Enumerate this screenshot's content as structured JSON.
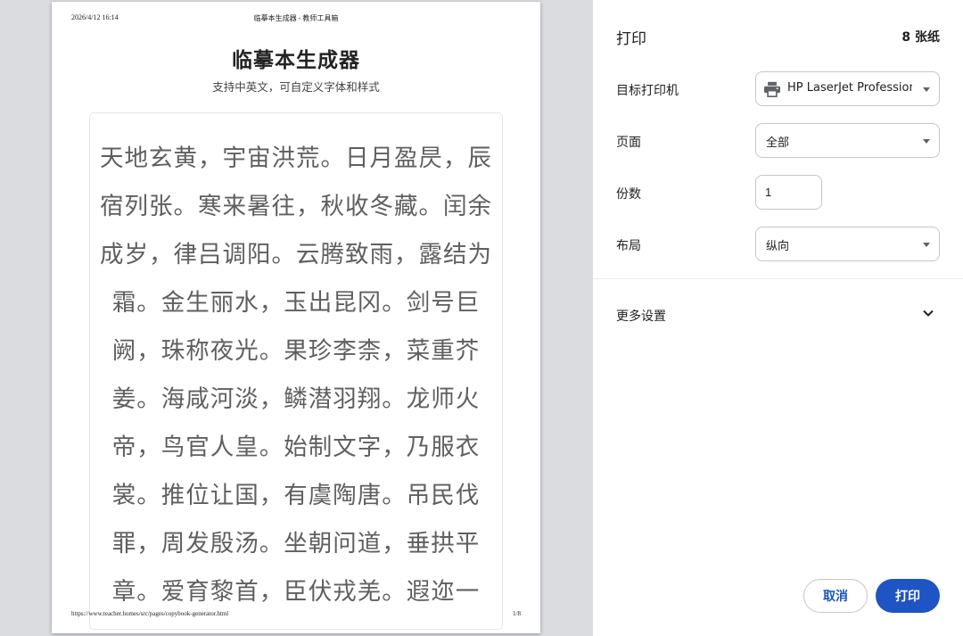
{
  "preview": {
    "header_datetime": "2026/4/12 16:14",
    "header_title": "临摹本生成器 - 教师工具箱",
    "doc_title": "临摹本生成器",
    "doc_subtitle": "支持中英文，可自定义字体和样式",
    "practice_lines": [
      "天地玄黄，宇宙洪荒。日月盈昃，辰",
      "宿列张。寒来暑往，秋收冬藏。闰余",
      "成岁，律吕调阳。云腾致雨，露结为",
      "霜。金生丽水，玉出昆冈。剑号巨",
      "阙，珠称夜光。果珍李柰，菜重芥",
      "姜。海咸河淡，鳞潜羽翔。龙师火",
      "帝，鸟官人皇。始制文字，乃服衣",
      "裳。推位让国，有虞陶唐。吊民伐",
      "罪，周发殷汤。坐朝问道，垂拱平",
      "章。爱育黎首，臣伏戎羌。遐迩一"
    ],
    "footer_url": "https://www.teacher.homes/src/pages/copybook-generator.html",
    "footer_page": "1/8"
  },
  "print_panel": {
    "title": "打印",
    "sheet_count": "8 张纸",
    "destination_label": "目标打印机",
    "destination_value": "HP LaserJet Professional",
    "destination_icon": "printer-icon",
    "pages_label": "页面",
    "pages_value": "全部",
    "copies_label": "份数",
    "copies_value": "1",
    "layout_label": "布局",
    "layout_value": "纵向",
    "more_settings_label": "更多设置",
    "more_settings_icon": "chevron-down-icon",
    "cancel_label": "取消",
    "print_label": "打印"
  },
  "colors": {
    "preview_background": "#dadce0",
    "print_button": "#1f54c4",
    "cancel_text": "#1a56b8",
    "practice_text": "#5f5f5f"
  }
}
